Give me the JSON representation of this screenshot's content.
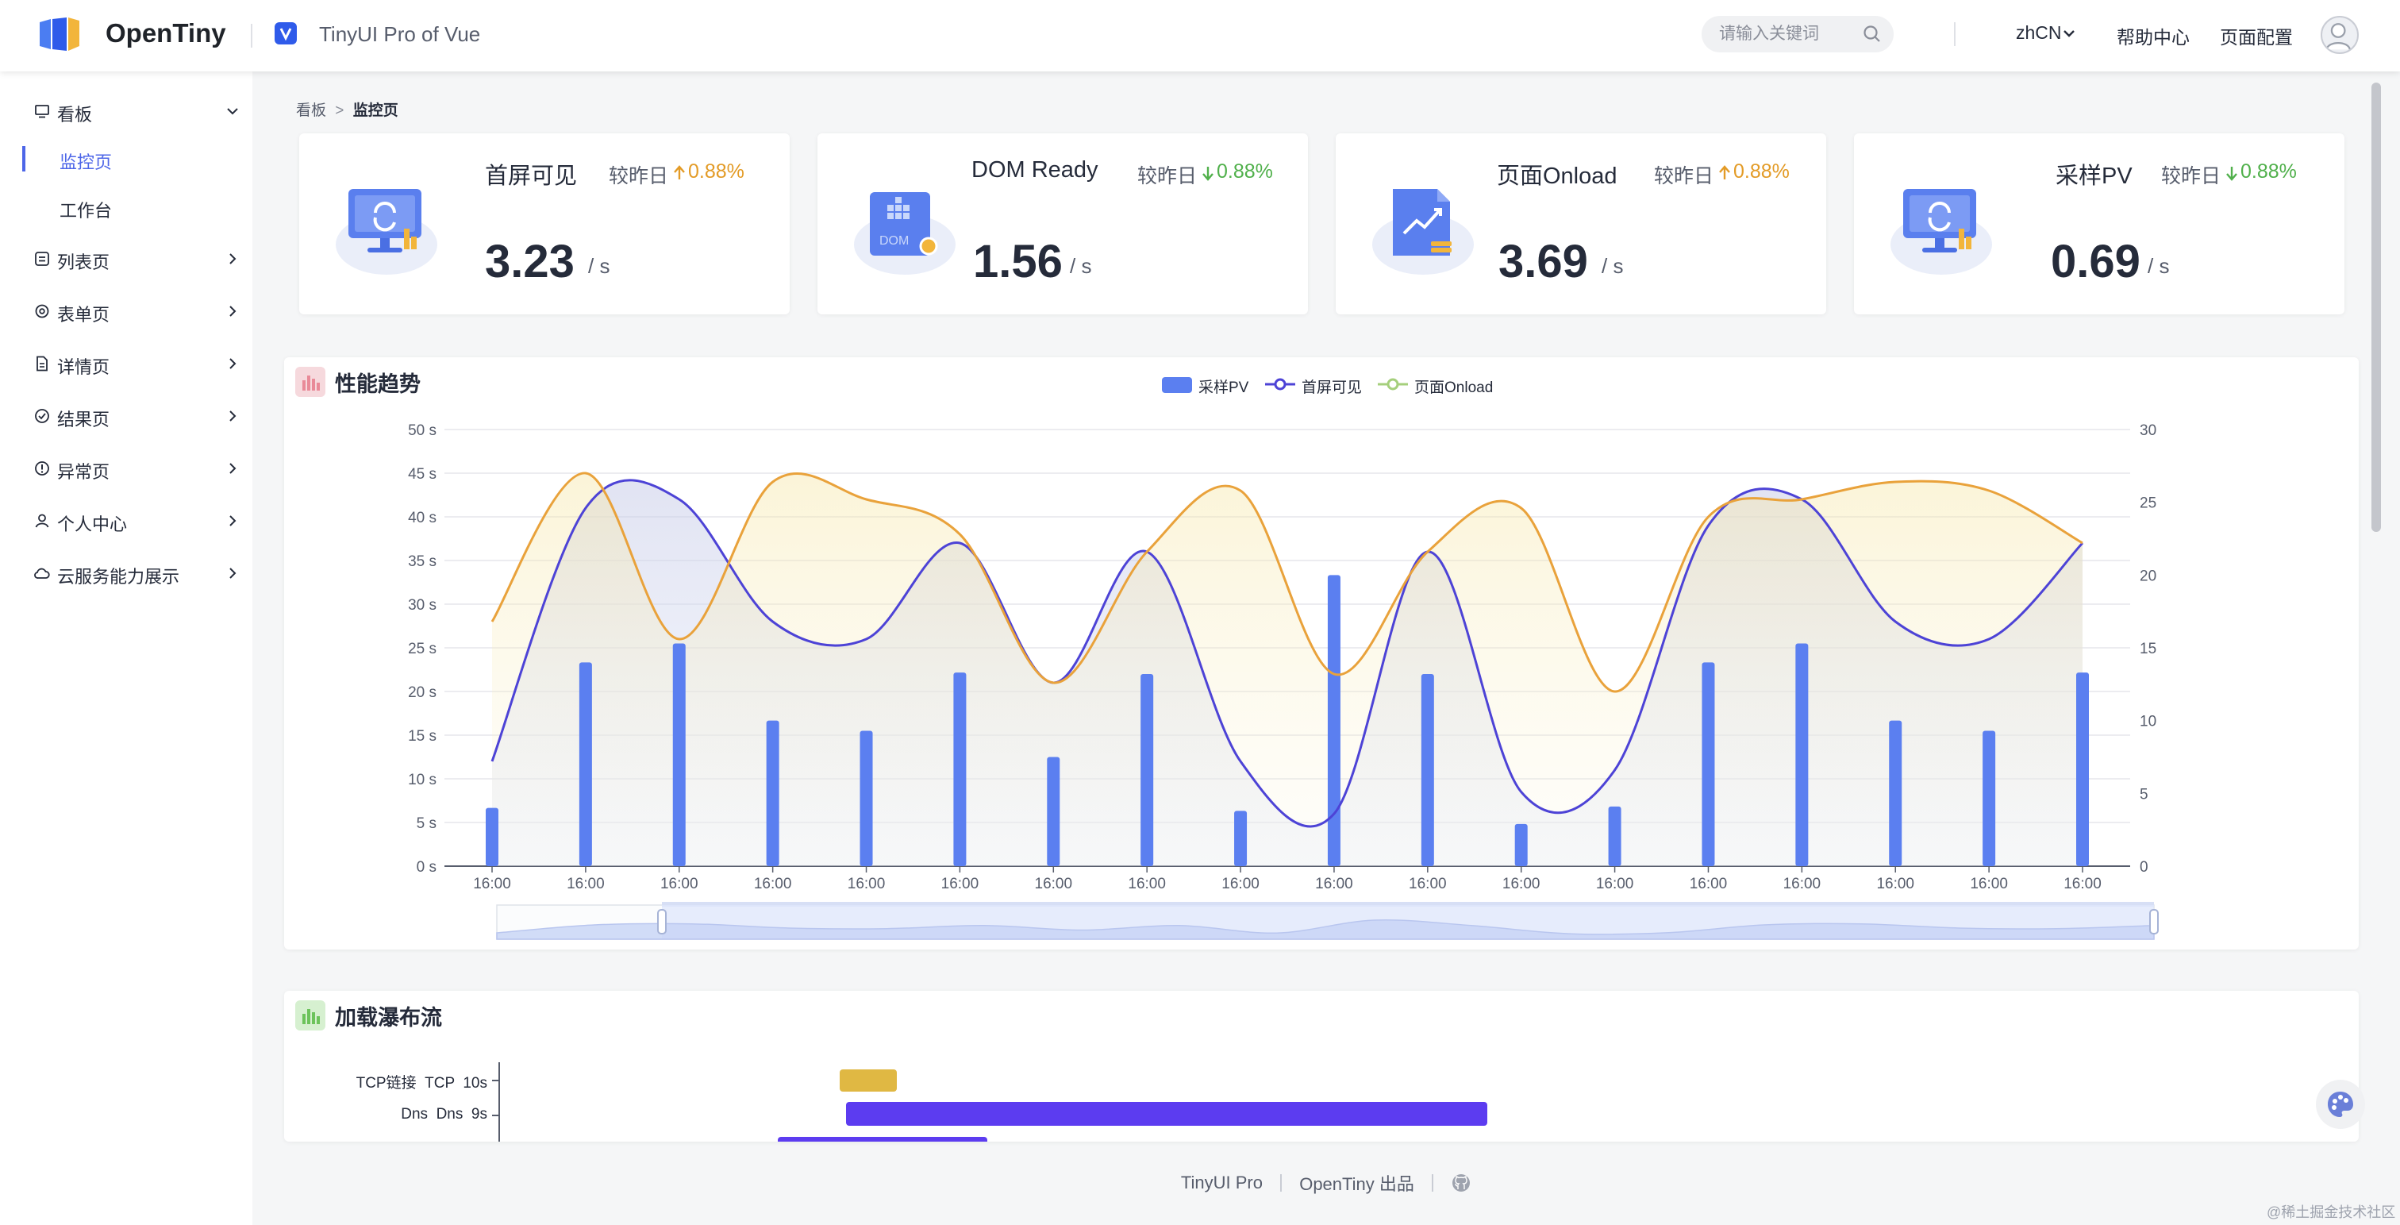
{
  "header": {
    "brand": "OpenTiny",
    "subtitle": "TinyUI Pro of Vue",
    "search_placeholder": "请输入关键词",
    "lang": "zhCN",
    "help": "帮助中心",
    "config": "页面配置"
  },
  "sidebar": {
    "groups": [
      {
        "label": "看板",
        "icon": "monitor-icon",
        "expanded": true,
        "children": [
          {
            "label": "监控页",
            "active": true
          },
          {
            "label": "工作台",
            "active": false
          }
        ]
      },
      {
        "label": "列表页",
        "icon": "list-icon"
      },
      {
        "label": "表单页",
        "icon": "form-icon"
      },
      {
        "label": "详情页",
        "icon": "document-icon"
      },
      {
        "label": "结果页",
        "icon": "check-circle-icon"
      },
      {
        "label": "异常页",
        "icon": "alert-icon"
      },
      {
        "label": "个人中心",
        "icon": "user-icon"
      },
      {
        "label": "云服务能力展示",
        "icon": "cloud-icon"
      }
    ]
  },
  "breadcrumb": {
    "root": "看板",
    "sep": ">",
    "current": "监控页"
  },
  "cards": [
    {
      "title": "首屏可见",
      "compare": "较昨日",
      "change": "0.88%",
      "direction": "up",
      "color": "#e39b26",
      "value": "3.23",
      "unit": "/ s"
    },
    {
      "title": "DOM Ready",
      "compare": "较昨日",
      "change": "0.88%",
      "direction": "down",
      "color": "#50b04b",
      "value": "1.56",
      "unit": "/ s"
    },
    {
      "title": "页面Onload",
      "compare": "较昨日",
      "change": "0.88%",
      "direction": "up",
      "color": "#e39b26",
      "value": "3.69",
      "unit": "/ s"
    },
    {
      "title": "采样PV",
      "compare": "较昨日",
      "change": "0.88%",
      "direction": "down",
      "color": "#50b04b",
      "value": "0.69",
      "unit": "/ s"
    }
  ],
  "trend": {
    "title": "性能趋势"
  },
  "waterfall": {
    "title": "加载瀑布流",
    "rows": [
      {
        "label": "TCP链接  TCP  10s"
      },
      {
        "label": "Dns  Dns  9s"
      }
    ]
  },
  "chart_data": {
    "type": "bar",
    "title": "",
    "x": [
      "16:00",
      "16:00",
      "16:00",
      "16:00",
      "16:00",
      "16:00",
      "16:00",
      "16:00",
      "16:00",
      "16:00",
      "16:00",
      "16:00",
      "16:00",
      "16:00",
      "16:00",
      "16:00",
      "16:00",
      "16:00"
    ],
    "y_left_ticks": [
      "0 s",
      "5 s",
      "10 s",
      "15 s",
      "20 s",
      "25 s",
      "30 s",
      "35 s",
      "40 s",
      "45 s",
      "50 s"
    ],
    "y_right_ticks": [
      "0",
      "5",
      "10",
      "15",
      "20",
      "25",
      "30"
    ],
    "ylim_left": [
      0,
      50
    ],
    "ylim_right": [
      0,
      30
    ],
    "legend_position": "top-center",
    "grid": true,
    "series": [
      {
        "name": "采样PV",
        "kind": "bar",
        "axis": "right",
        "color": "#5b7ff0",
        "values": [
          4,
          14,
          15.3,
          10,
          9.3,
          13.3,
          7.5,
          13.2,
          3.8,
          20,
          13.2,
          2.9,
          4.1,
          14,
          15.3,
          10,
          9.3,
          13.3
        ]
      },
      {
        "name": "首屏可见",
        "kind": "line",
        "axis": "left",
        "color": "#4d43d6",
        "values": [
          12,
          41,
          42,
          28,
          26,
          37,
          21,
          36,
          12,
          6,
          36,
          8.5,
          11,
          39,
          42,
          28,
          26,
          37
        ]
      },
      {
        "name": "页面Onload",
        "kind": "line",
        "axis": "left",
        "color": "#e9a23b",
        "values": [
          28,
          45,
          26,
          44,
          42,
          38,
          21,
          36,
          43,
          22,
          36,
          41,
          20,
          40,
          42,
          44,
          43,
          37
        ]
      }
    ]
  },
  "footer": {
    "left": "TinyUI Pro",
    "right": "OpenTiny 出品"
  },
  "watermark": "@稀土掘金技术社区"
}
